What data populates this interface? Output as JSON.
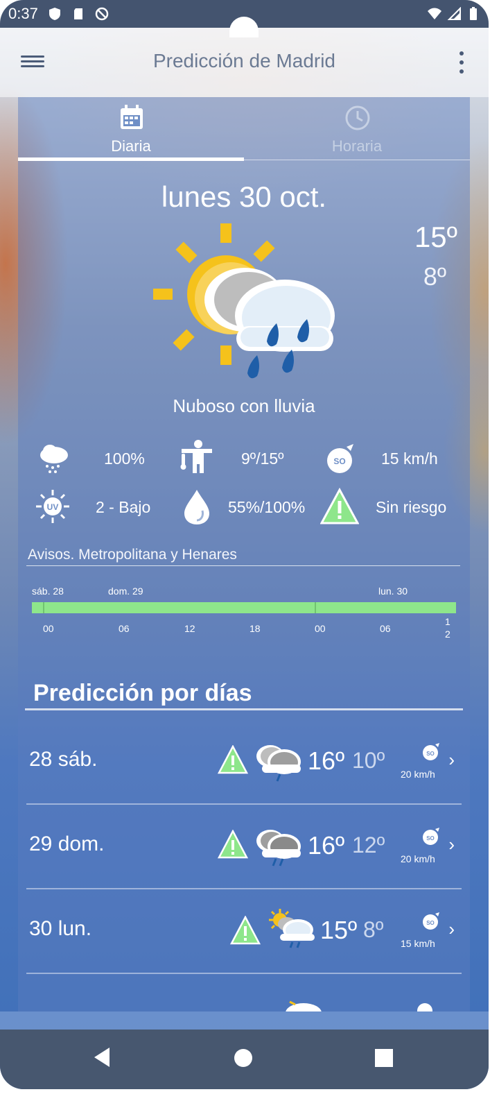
{
  "status_bar": {
    "time": "0:37"
  },
  "app_bar": {
    "title": "Predicción de Madrid"
  },
  "tabs": [
    {
      "label": "Diaria",
      "icon": "calendar-icon",
      "selected": true
    },
    {
      "label": "Horaria",
      "icon": "clock-icon",
      "selected": false
    }
  ],
  "today": {
    "date": "lunes 30 oct.",
    "max": "15º",
    "min": "8º",
    "condition": "Nuboso con lluvia",
    "icon": "partly-cloudy-rain-icon"
  },
  "stats": [
    {
      "icon": "rain-probability-icon",
      "value": "100%"
    },
    {
      "icon": "thermal-sensation-icon",
      "value": "9º/15º"
    },
    {
      "icon": "wind-icon",
      "value": "15 km/h"
    },
    {
      "icon": "uv-index-icon",
      "value": "2 - Bajo"
    },
    {
      "icon": "humidity-icon",
      "value": "55%/100%"
    },
    {
      "icon": "warning-icon",
      "value": "Sin riesgo"
    }
  ],
  "alerts": {
    "title": "Avisos. Metropolitana y Henares",
    "days": [
      "sáb. 28",
      "dom. 29",
      "lun. 30"
    ],
    "hours": [
      "00",
      "06",
      "12",
      "18",
      "00",
      "06",
      "1",
      "2"
    ],
    "color": "#8ee68b"
  },
  "forecast": {
    "title": "Predicción por días",
    "days": [
      {
        "name": "28 sáb.",
        "max": "16º",
        "min": "10º",
        "wind": "20 km/h",
        "wind_badge": "SO"
      },
      {
        "name": "29 dom.",
        "max": "16º",
        "min": "12º",
        "wind": "20 km/h",
        "wind_badge": "SO"
      },
      {
        "name": "30 lun.",
        "max": "15º",
        "min": "8º",
        "wind": "15 km/h",
        "wind_badge": "SO"
      }
    ]
  },
  "colors": {
    "status_bar": "#44546f",
    "accent_sun": "#f5c21b",
    "rain": "#1f5ea8",
    "warning_green": "#8ee68b"
  }
}
